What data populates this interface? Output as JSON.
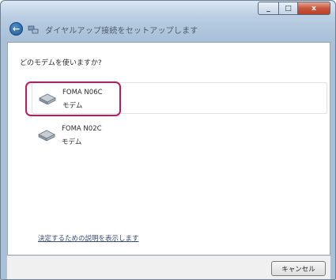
{
  "window": {
    "title": "ダイヤルアップ接続をセットアップします",
    "controls": {
      "minimize": "_",
      "maximize": "□",
      "close": "x"
    },
    "back_glyph": "←"
  },
  "content": {
    "question": "どのモデムを使いますか?",
    "modems": [
      {
        "name": "FOMA N06C",
        "type": "モデム",
        "selected": true,
        "icon": "modem-icon"
      },
      {
        "name": "FOMA N02C",
        "type": "モデム",
        "selected": false,
        "icon": "modem-icon"
      }
    ],
    "help_link": "決定するための説明を表示します"
  },
  "footer": {
    "cancel_label": "キャンセル"
  },
  "colors": {
    "highlight_border": "#c2185b",
    "titlebar": "#b9cde2",
    "link": "#3a4a7a"
  }
}
